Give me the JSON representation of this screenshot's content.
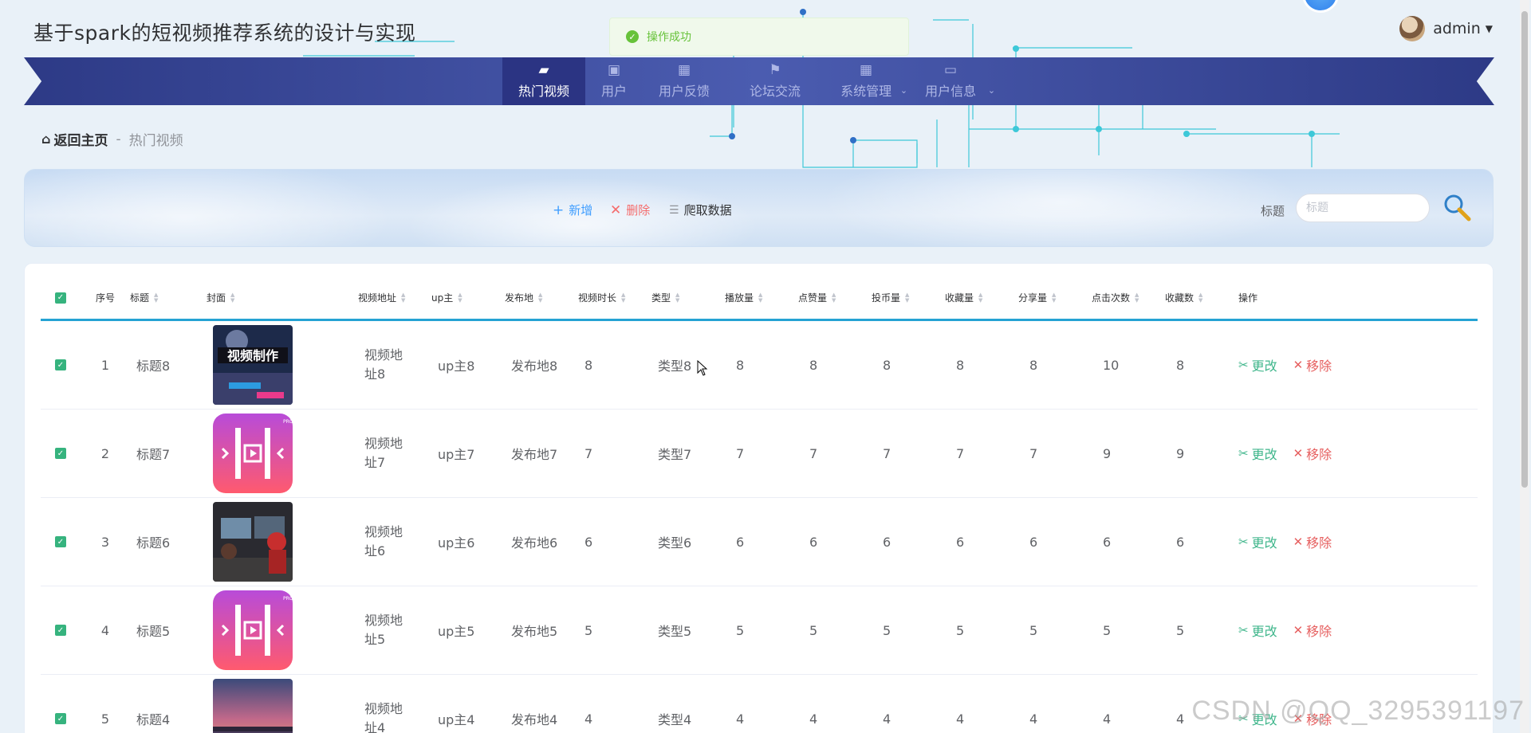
{
  "app": {
    "title": "基于spark的短视频推荐系统的设计与实现"
  },
  "toast": {
    "message": "操作成功"
  },
  "user": {
    "name": "admin"
  },
  "nav": {
    "items": [
      {
        "label": "热门视频",
        "icon": "video-icon",
        "active": true
      },
      {
        "label": "用户",
        "icon": "clipboard-icon"
      },
      {
        "label": "用户反馈",
        "icon": "grid-icon"
      },
      {
        "label": "论坛交流",
        "icon": "flag-icon"
      },
      {
        "label": "系统管理",
        "icon": "grid-icon",
        "dropdown": true
      },
      {
        "label": "用户信息",
        "icon": "card-icon",
        "dropdown": true
      }
    ]
  },
  "breadcrumb": {
    "home": "返回主页",
    "separator": "-",
    "current": "热门视频"
  },
  "toolbar": {
    "add_label": "新增",
    "delete_label": "删除",
    "crawl_label": "爬取数据",
    "search_label": "标题",
    "search_placeholder": "标题",
    "search_value": ""
  },
  "table": {
    "headers": [
      "序号",
      "标题",
      "封面",
      "视频地址",
      "up主",
      "发布地",
      "视频时长",
      "类型",
      "播放量",
      "点赞量",
      "投币量",
      "收藏量",
      "分享量",
      "点击次数",
      "收藏数",
      "操作"
    ],
    "edit_label": "更改",
    "remove_label": "移除",
    "rows": [
      {
        "idx": "1",
        "title": "标题8",
        "cover": "video-production-image",
        "url": "视频地址8",
        "up": "up主8",
        "loc": "发布地8",
        "dur": "8",
        "type": "类型8",
        "play": "8",
        "like": "8",
        "coin": "8",
        "fav": "8",
        "share": "8",
        "click": "10",
        "favcount": "8"
      },
      {
        "idx": "2",
        "title": "标题7",
        "cover": "pink-app-icon",
        "url": "视频地址7",
        "up": "up主7",
        "loc": "发布地7",
        "dur": "7",
        "type": "类型7",
        "play": "7",
        "like": "7",
        "coin": "7",
        "fav": "7",
        "share": "7",
        "click": "9",
        "favcount": "9"
      },
      {
        "idx": "3",
        "title": "标题6",
        "cover": "editing-studio-photo",
        "url": "视频地址6",
        "up": "up主6",
        "loc": "发布地6",
        "dur": "6",
        "type": "类型6",
        "play": "6",
        "like": "6",
        "coin": "6",
        "fav": "6",
        "share": "6",
        "click": "6",
        "favcount": "6"
      },
      {
        "idx": "4",
        "title": "标题5",
        "cover": "pink-app-icon",
        "url": "视频地址5",
        "up": "up主5",
        "loc": "发布地5",
        "dur": "5",
        "type": "类型5",
        "play": "5",
        "like": "5",
        "coin": "5",
        "fav": "5",
        "share": "5",
        "click": "5",
        "favcount": "5"
      },
      {
        "idx": "5",
        "title": "标题4",
        "cover": "sunset-photo",
        "url": "视频地址4",
        "up": "up主4",
        "loc": "发布地4",
        "dur": "4",
        "type": "类型4",
        "play": "4",
        "like": "4",
        "coin": "4",
        "fav": "4",
        "share": "4",
        "click": "4",
        "favcount": "4"
      }
    ]
  },
  "cover_text": {
    "video_production": "视频制作"
  },
  "watermark": "CSDN @QQ_3295391197",
  "colors": {
    "nav": "#3b4a9e",
    "accent": "#25a3d3",
    "edit": "#3fb68b",
    "delete": "#e65f5f",
    "checkbox": "#36b37e"
  }
}
